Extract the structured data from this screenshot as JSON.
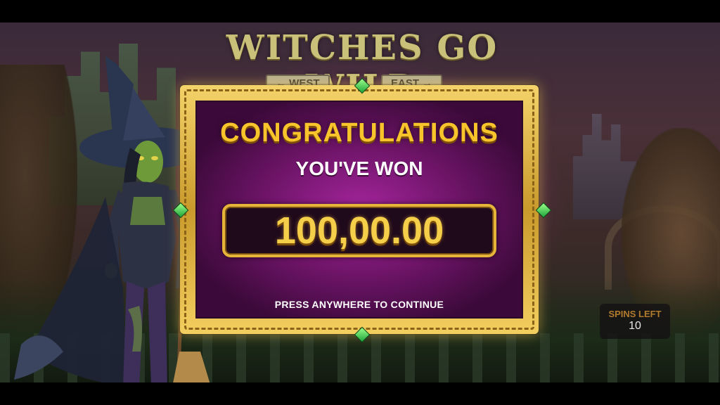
{
  "game": {
    "title": "WITCHES GO WILD",
    "sign_west": "← WEST",
    "sign_east": "EAST →"
  },
  "win_dialog": {
    "heading": "CONGRATULATIONS",
    "subheading": "YOU'VE WON",
    "amount": "100,00.00",
    "continue_prompt": "PRESS ANYWHERE TO CONTINUE"
  },
  "spins": {
    "label": "SPINS LEFT",
    "value": "10"
  },
  "colors": {
    "gold": "#f8c42c",
    "frame_gold": "#e7b43a",
    "panel_magenta": "#a5259d",
    "gem_green": "#1ea53a"
  }
}
